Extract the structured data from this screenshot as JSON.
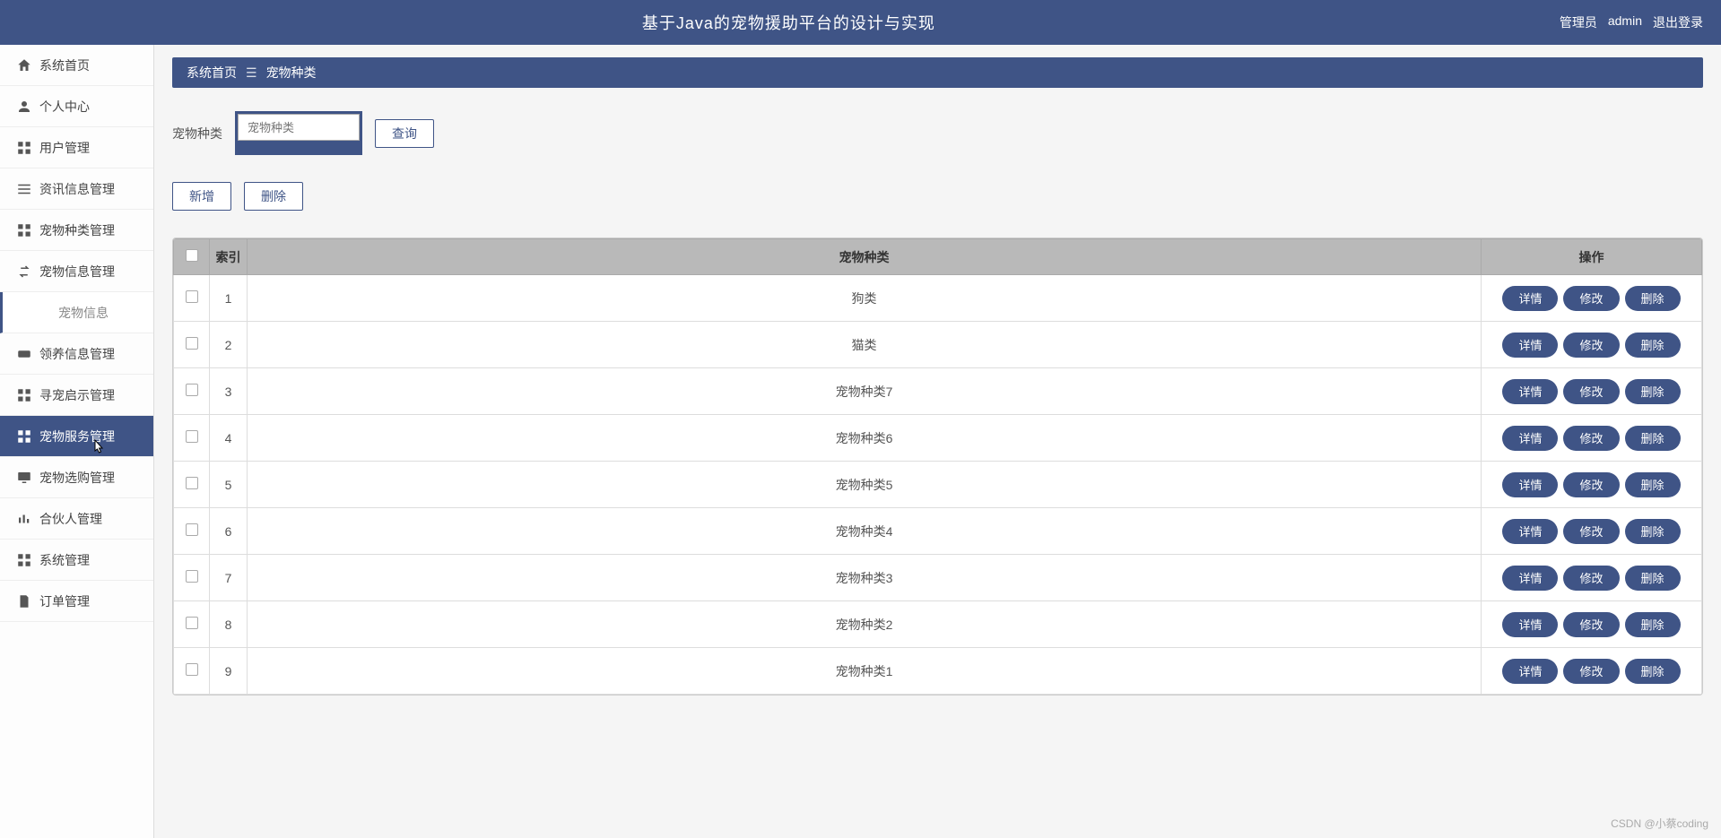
{
  "header": {
    "title": "基于Java的宠物援助平台的设计与实现",
    "role": "管理员",
    "username": "admin",
    "logout": "退出登录"
  },
  "sidebar": {
    "items": [
      {
        "label": "系统首页",
        "icon": "home"
      },
      {
        "label": "个人中心",
        "icon": "person"
      },
      {
        "label": "用户管理",
        "icon": "grid"
      },
      {
        "label": "资讯信息管理",
        "icon": "list"
      },
      {
        "label": "宠物种类管理",
        "icon": "grid"
      },
      {
        "label": "宠物信息管理",
        "icon": "swap"
      },
      {
        "label": "宠物信息",
        "icon": "",
        "sub": true,
        "active": true
      },
      {
        "label": "领养信息管理",
        "icon": "ticket"
      },
      {
        "label": "寻宠启示管理",
        "icon": "grid"
      },
      {
        "label": "宠物服务管理",
        "icon": "grid",
        "hovered": true
      },
      {
        "label": "宠物选购管理",
        "icon": "monitor"
      },
      {
        "label": "合伙人管理",
        "icon": "bars"
      },
      {
        "label": "系统管理",
        "icon": "grid"
      },
      {
        "label": "订单管理",
        "icon": "doc"
      }
    ]
  },
  "breadcrumb": {
    "home": "系统首页",
    "current": "宠物种类"
  },
  "search": {
    "label": "宠物种类",
    "placeholder": "宠物种类",
    "button": "查询"
  },
  "toolbar": {
    "add": "新增",
    "delete": "删除"
  },
  "table": {
    "headers": {
      "index": "索引",
      "type": "宠物种类",
      "ops": "操作"
    },
    "ops": {
      "detail": "详情",
      "edit": "修改",
      "delete": "删除"
    },
    "rows": [
      {
        "idx": "1",
        "type": "狗类"
      },
      {
        "idx": "2",
        "type": "猫类"
      },
      {
        "idx": "3",
        "type": "宠物种类7"
      },
      {
        "idx": "4",
        "type": "宠物种类6"
      },
      {
        "idx": "5",
        "type": "宠物种类5"
      },
      {
        "idx": "6",
        "type": "宠物种类4"
      },
      {
        "idx": "7",
        "type": "宠物种类3"
      },
      {
        "idx": "8",
        "type": "宠物种类2"
      },
      {
        "idx": "9",
        "type": "宠物种类1"
      }
    ]
  },
  "watermark": "CSDN @小蔡coding"
}
